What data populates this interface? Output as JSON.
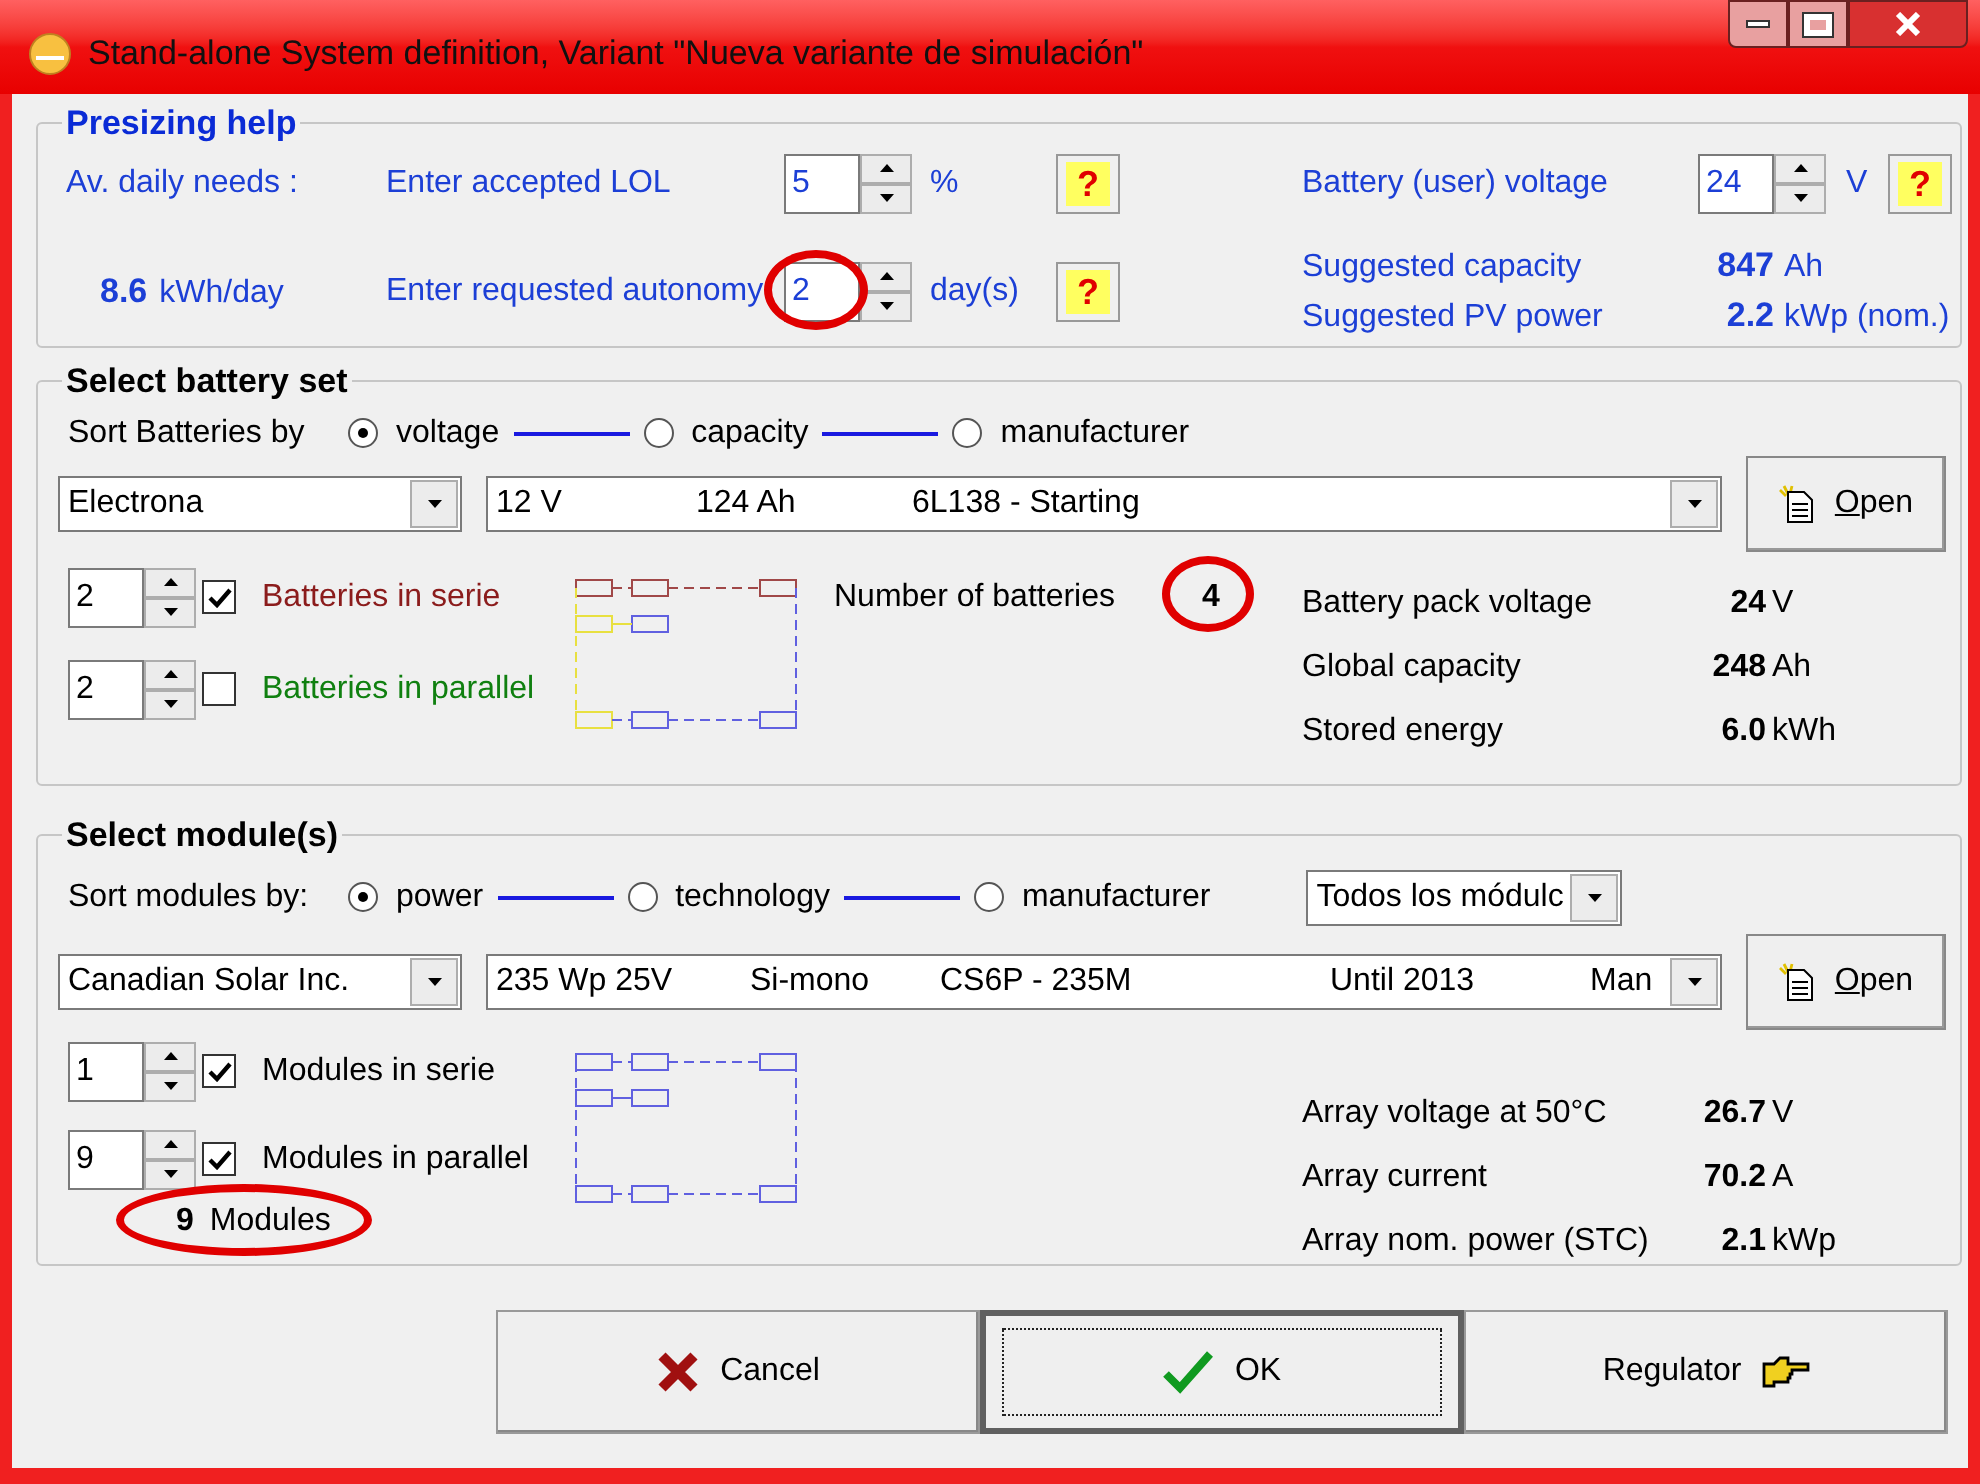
{
  "window": {
    "title": "Stand-alone System definition, Variant  \"Nueva variante de simulación\""
  },
  "presizing": {
    "title": "Presizing help",
    "daily_needs": {
      "label": "Av. daily needs :",
      "value": "8.6",
      "unit": "kWh/day"
    },
    "lol": {
      "label": "Enter accepted LOL",
      "value": "5",
      "unit": "%",
      "help": "?",
      "highlighted": false
    },
    "autonomy": {
      "label": "Enter requested autonomy",
      "value": "2",
      "unit": "day(s)",
      "help": "?",
      "highlighted": true
    },
    "battery_voltage": {
      "label": "Battery (user) voltage",
      "value": "24",
      "unit": "V",
      "help": "?"
    },
    "suggested": [
      {
        "label": "Suggested capacity",
        "value": "847",
        "unit": "Ah"
      },
      {
        "label": "Suggested PV power",
        "value": "2.2",
        "unit": "kWp (nom.)"
      }
    ]
  },
  "battery": {
    "title": "Select battery set",
    "sort_label": "Sort Batteries by",
    "sort_options": [
      {
        "label": "voltage",
        "selected": true
      },
      {
        "label": "capacity",
        "selected": false
      },
      {
        "label": "manufacturer",
        "selected": false
      }
    ],
    "manufacturer": "Electrona",
    "model_columns": [
      "12 V",
      "124 Ah",
      "6L138 - Starting"
    ],
    "open_button": "Open",
    "series": {
      "value": "2",
      "checked": true,
      "label": "Batteries in serie"
    },
    "parallel": {
      "value": "2",
      "checked": false,
      "label": "Batteries in parallel"
    },
    "count_label": "Number of batteries",
    "count_value": "4",
    "stats": [
      {
        "label": "Battery pack voltage",
        "value": "24",
        "unit": "V"
      },
      {
        "label": "Global capacity",
        "value": "248",
        "unit": "Ah"
      },
      {
        "label": "Stored energy",
        "value": "6.0",
        "unit": "kWh"
      }
    ]
  },
  "modules": {
    "title": "Select module(s)",
    "sort_label": "Sort modules by:",
    "sort_options": [
      {
        "label": "power",
        "selected": true
      },
      {
        "label": "technology",
        "selected": false
      },
      {
        "label": "manufacturer",
        "selected": false
      }
    ],
    "filter": "Todos los módulc",
    "manufacturer": "Canadian Solar Inc.",
    "model_columns": [
      "235 Wp 25V",
      "Si-mono",
      "CS6P - 235M",
      "Until 2013",
      "Man"
    ],
    "open_button": "Open",
    "series": {
      "value": "1",
      "checked": true,
      "label": "Modules in serie"
    },
    "parallel": {
      "value": "9",
      "checked": true,
      "label": "Modules in parallel"
    },
    "total_value": "9",
    "total_label": "Modules",
    "stats": [
      {
        "label": "Array voltage at 50°C",
        "value": "26.7",
        "unit": "V"
      },
      {
        "label": "Array current",
        "value": "70.2",
        "unit": "A"
      },
      {
        "label": "Array nom. power (STC)",
        "value": "2.1",
        "unit": "kWp"
      }
    ]
  },
  "buttons": [
    {
      "kind": "cancel",
      "label": "Cancel",
      "focused": false
    },
    {
      "kind": "ok",
      "label": "OK",
      "focused": true
    },
    {
      "kind": "regulator",
      "label": "Regulator",
      "focused": false
    }
  ]
}
